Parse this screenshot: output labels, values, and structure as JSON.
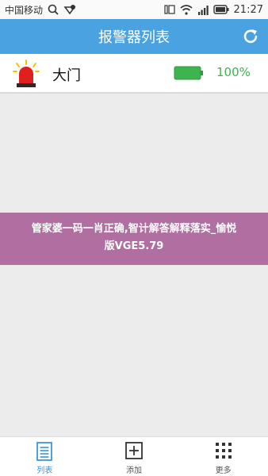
{
  "status_bar": {
    "carrier": "中国移动",
    "time": "21:27",
    "icons": [
      "search-icon",
      "notification-icon",
      "signal-icon",
      "wifi-icon",
      "signal-bars-icon",
      "battery-icon"
    ]
  },
  "header": {
    "title": "报警器列表",
    "refresh_icon": "refresh-icon"
  },
  "alarms": [
    {
      "name": "大门",
      "battery": "100%",
      "battery_fraction": 1.0,
      "icon": "siren-icon"
    }
  ],
  "banner": {
    "line1": "管家婆一码一肖正确,智计解答解释落实_愉悦",
    "line2": "版VGE5.79"
  },
  "bottom_nav": {
    "items": [
      {
        "label": "列表",
        "icon": "list-icon",
        "active": true
      },
      {
        "label": "添加",
        "icon": "add-icon",
        "active": false
      },
      {
        "label": "更多",
        "icon": "more-grid-icon",
        "active": false
      }
    ]
  },
  "colors": {
    "header": "#4aa3e0",
    "battery": "#3fb34f",
    "banner": "#b06fa0",
    "active_nav": "#3a96d8"
  }
}
